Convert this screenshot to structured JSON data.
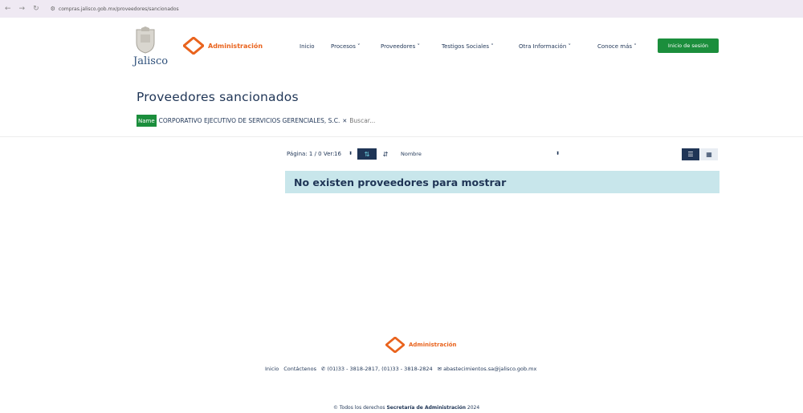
{
  "browser": {
    "url": "compras.jalisco.gob.mx/proveedores/sancionados",
    "back_icon": "arrow-left",
    "forward_icon": "arrow-right",
    "reload_icon": "reload"
  },
  "header": {
    "jalisco_logo_text": "Jalisco",
    "admin_logo_text": "Administración",
    "nav": [
      {
        "label": "Inicio"
      },
      {
        "label": "Procesos ˅"
      },
      {
        "label": "Proveedores ˅"
      },
      {
        "label": "Testigos Sociales ˅"
      },
      {
        "label": "Otra Información ˅"
      },
      {
        "label": "Conoce más ˅"
      }
    ],
    "login_label": "Inicio de sesión"
  },
  "main": {
    "title": "Proveedores sancionados",
    "filter": {
      "tag": "Name",
      "value": "CORPORATIVO EJECUTIVO DE SERVICIOS GERENCIALES, S.C.",
      "remove_icon": "x",
      "search_placeholder": "Buscar..."
    },
    "toolbar": {
      "pagination": "Página: 1 / 0 Ver:",
      "per_page": "16",
      "sort_field": "Nombre"
    },
    "empty_message": "No existen proveedores para mostrar"
  },
  "footer": {
    "admin_logo_text": "Administración",
    "links": [
      "Inicio",
      "Contáctenos"
    ],
    "phone": "(01)33 - 3818-2817, (01)33 - 3818-2824",
    "email": "abastecimientos.sa@jalisco.gob.mx",
    "copyright_prefix": "© Todos los derechos",
    "copyright_org": "Secretaría de Administración",
    "copyright_year": "2024"
  },
  "colors": {
    "brand_navy": "#1f3556",
    "brand_green": "#1b8e3c",
    "brand_orange": "#e9631d",
    "alert_bg": "#c8e6eb"
  }
}
